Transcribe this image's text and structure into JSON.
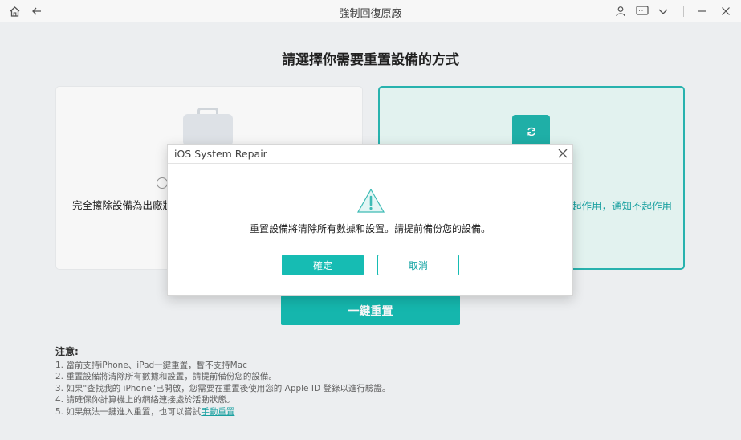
{
  "window": {
    "title": "強制回復原廠"
  },
  "page": {
    "heading": "請選擇你需要重置設備的方式"
  },
  "options": {
    "left_description": "完全擦除設備為出廠狀",
    "right_description": "起作用，通知不起作用"
  },
  "primary_button": {
    "label": "一鍵重置"
  },
  "notes": {
    "title": "注意:",
    "items": [
      "1. 當前支持iPhone、iPad一鍵重置，暫不支持Mac",
      "2. 重置設備將清除所有數據和設置，請提前備份您的設備。",
      "3. 如果\"查找我的 iPhone\"已開啟，您需要在重置後使用您的 Apple ID 登錄以進行驗證。",
      "4. 請確保你計算機上的網絡連接處於活動狀態。",
      "5. 如果無法一鍵進入重置，也可以嘗試"
    ],
    "link_label": "手動重置"
  },
  "dialog": {
    "title": "iOS System Repair",
    "message": "重置設備將清除所有數據和設置。請提前備份您的設備。",
    "ok_label": "確定",
    "cancel_label": "取消"
  },
  "colors": {
    "accent": "#16bcb3",
    "accent_text": "#1aa6a6",
    "selected_card_bg": "#eafaf7",
    "warning": "#3dbbb5"
  },
  "icons": {
    "home": "home-icon",
    "back": "back-arrow-icon",
    "user": "user-icon",
    "feedback": "message-icon",
    "dropdown": "chevron-down-icon",
    "minimize": "minimize-icon",
    "close": "close-icon",
    "warning": "warning-icon",
    "medical_kit": "medical-kit-icon",
    "refresh_phone": "refresh-phone-icon"
  }
}
